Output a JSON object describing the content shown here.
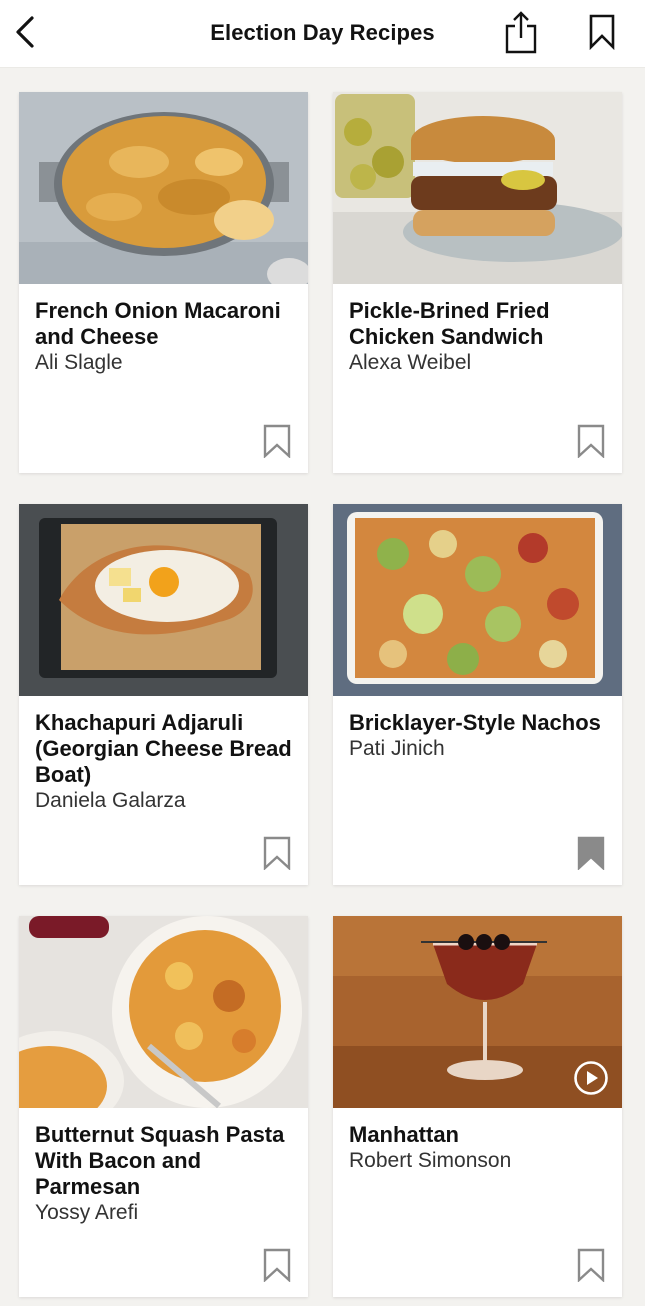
{
  "header": {
    "title": "Election Day Recipes",
    "back_icon": "chevron-left-icon",
    "share_icon": "share-icon",
    "bookmark_icon": "bookmark-outline-icon"
  },
  "recipes": [
    {
      "title": "French Onion Macaroni and Cheese",
      "author": "Ali Slagle",
      "saved": false,
      "has_video": false
    },
    {
      "title": "Pickle-Brined Fried Chicken Sandwich",
      "author": "Alexa Weibel",
      "saved": false,
      "has_video": false
    },
    {
      "title": "Khachapuri Adjaruli (Georgian Cheese Bread Boat)",
      "author": "Daniela Galarza",
      "saved": false,
      "has_video": false
    },
    {
      "title": "Bricklayer-Style Nachos",
      "author": "Pati Jinich",
      "saved": true,
      "has_video": false
    },
    {
      "title": "Butternut Squash Pasta With Bacon and Parmesan",
      "author": "Yossy Arefi",
      "saved": false,
      "has_video": false
    },
    {
      "title": "Manhattan",
      "author": "Robert Simonson",
      "saved": false,
      "has_video": true
    }
  ],
  "colors": {
    "text": "#121212",
    "author": "#333333",
    "icon": "#8a8a8a",
    "background": "#f3f2ef"
  }
}
